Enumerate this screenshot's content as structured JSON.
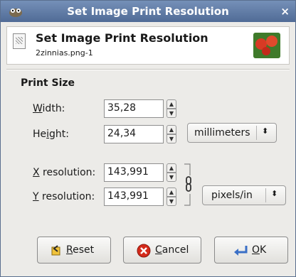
{
  "window": {
    "title": "Set Image Print Resolution",
    "close_glyph": "×"
  },
  "header": {
    "title": "Set Image Print Resolution",
    "subtitle": "2zinnias.png-1"
  },
  "print_size": {
    "section_title": "Print Size",
    "width": {
      "label_mn": "W",
      "label_rest": "idth:",
      "value": "35,28"
    },
    "height": {
      "label_pre": "He",
      "label_mn": "i",
      "label_rest": "ght:",
      "value": "24,34"
    },
    "size_unit": "millimeters",
    "x_resolution": {
      "label_mn": "X",
      "label_rest": " resolution:",
      "value": "143,991"
    },
    "y_resolution": {
      "label_mn": "Y",
      "label_rest": " resolution:",
      "value": "143,991"
    },
    "resolution_unit": "pixels/in"
  },
  "buttons": {
    "reset": {
      "mn": "R",
      "rest": "eset"
    },
    "cancel": {
      "mn": "C",
      "rest": "ancel"
    },
    "ok": {
      "mn": "O",
      "rest": "K"
    }
  },
  "icons": {
    "wm": "gimp-wilber-icon",
    "header": "print-document-icon",
    "thumb": "image-thumbnail",
    "chain": "chain-link-icon",
    "reset": "reset-icon",
    "cancel": "cancel-icon",
    "ok": "ok-icon"
  },
  "colors": {
    "titlebar": "#506b96",
    "cancel": "#d42a1a",
    "reset": "#d9a21a",
    "ok": "#3a6fc6"
  }
}
